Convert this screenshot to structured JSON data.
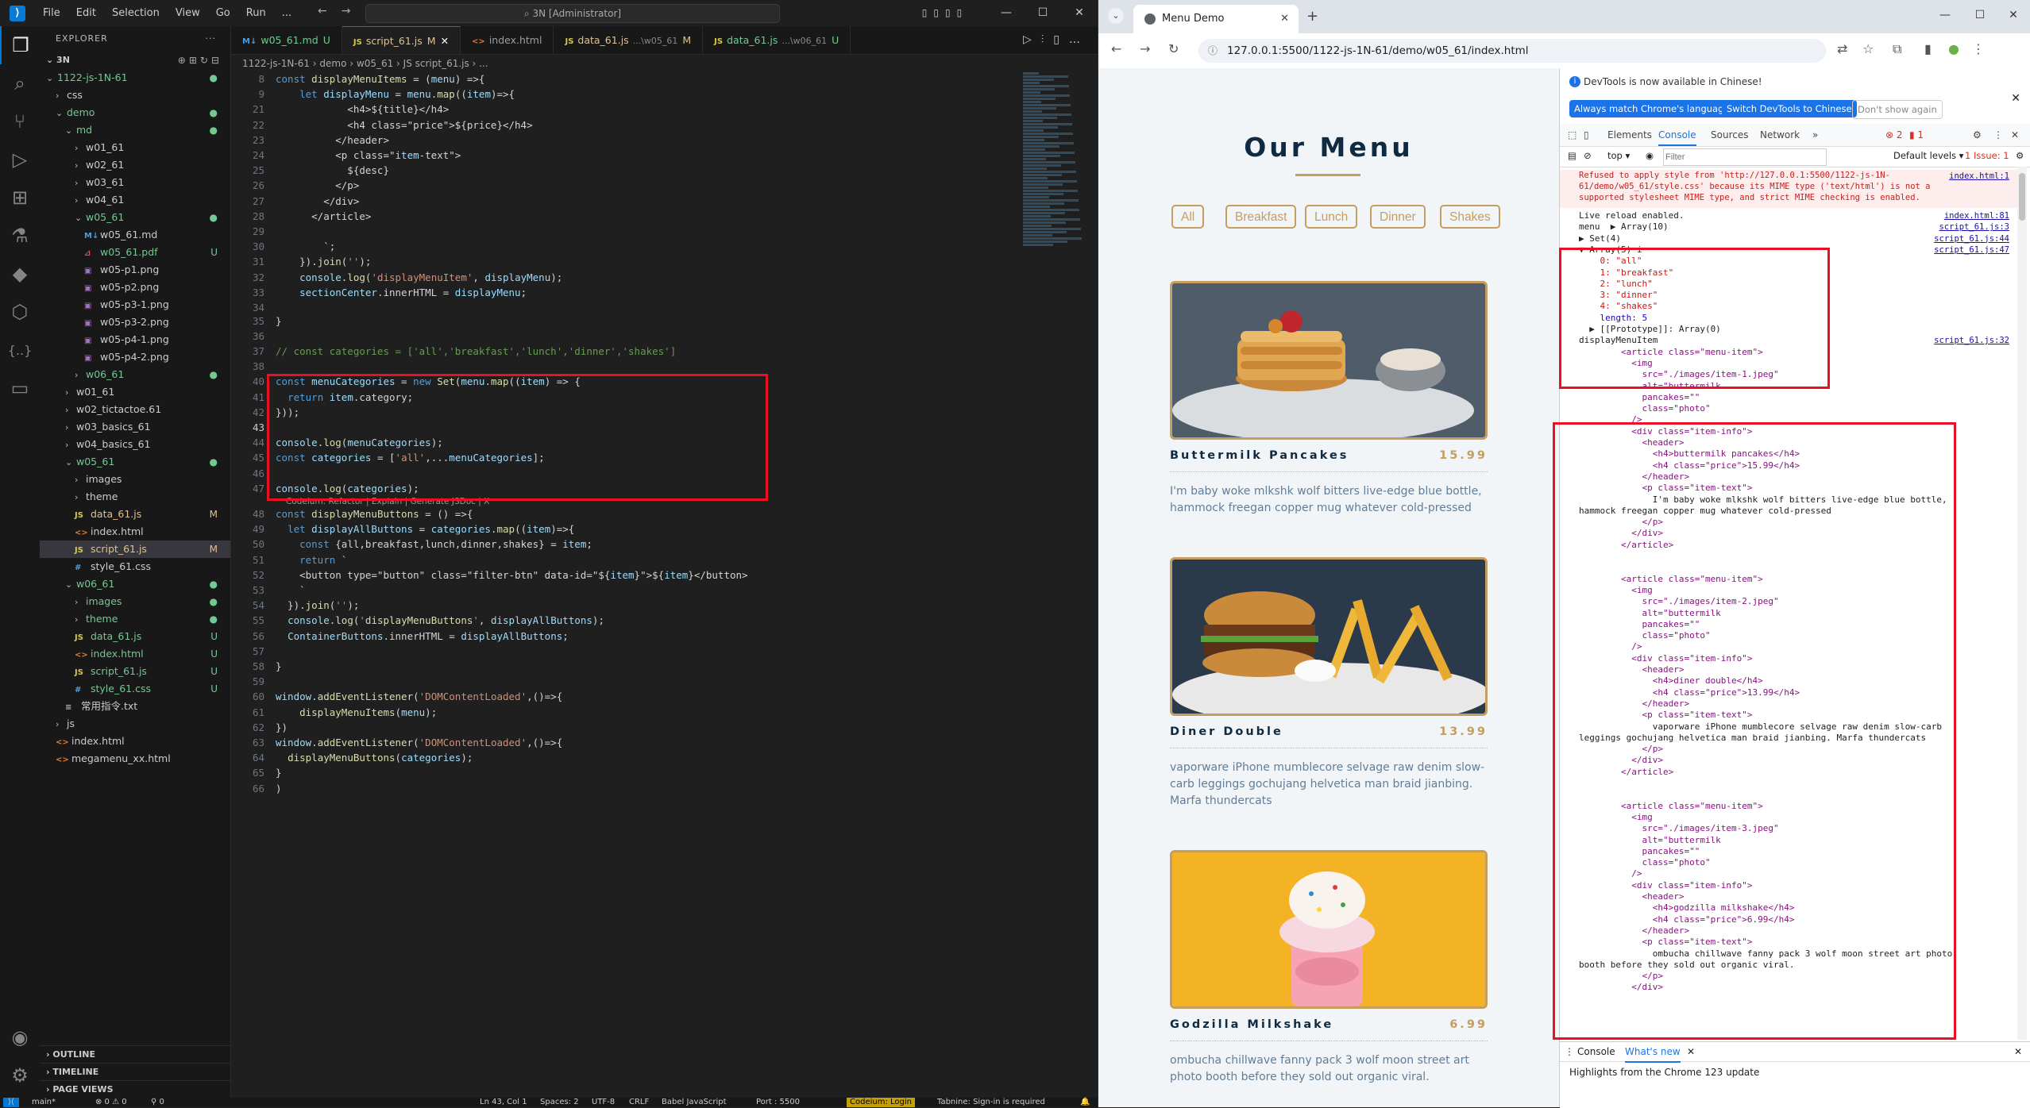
{
  "vscode": {
    "menu": [
      "File",
      "Edit",
      "Selection",
      "View",
      "Go",
      "Run",
      "..."
    ],
    "command_center": "3N [Administrator]",
    "explorer": {
      "header": "EXPLORER",
      "project": "3N",
      "tree": [
        {
          "label": "1122-js-1N-61",
          "depth": 0,
          "kind": "folder-open",
          "status": "dot"
        },
        {
          "label": "css",
          "depth": 1,
          "kind": "folder",
          "status": ""
        },
        {
          "label": "demo",
          "depth": 1,
          "kind": "folder-open",
          "status": "dot"
        },
        {
          "label": "md",
          "depth": 2,
          "kind": "folder-open",
          "status": "dot"
        },
        {
          "label": "w01_61",
          "depth": 3,
          "kind": "folder",
          "status": ""
        },
        {
          "label": "w02_61",
          "depth": 3,
          "kind": "folder",
          "status": ""
        },
        {
          "label": "w03_61",
          "depth": 3,
          "kind": "folder",
          "status": ""
        },
        {
          "label": "w04_61",
          "depth": 3,
          "kind": "folder",
          "status": ""
        },
        {
          "label": "w05_61",
          "depth": 3,
          "kind": "folder-open",
          "status": "dot"
        },
        {
          "label": "w05_61.md",
          "depth": 4,
          "kind": "md",
          "status": ""
        },
        {
          "label": "w05_61.pdf",
          "depth": 4,
          "kind": "pdf",
          "status": "U"
        },
        {
          "label": "w05-p1.png",
          "depth": 4,
          "kind": "img",
          "status": ""
        },
        {
          "label": "w05-p2.png",
          "depth": 4,
          "kind": "img",
          "status": ""
        },
        {
          "label": "w05-p3-1.png",
          "depth": 4,
          "kind": "img",
          "status": ""
        },
        {
          "label": "w05-p3-2.png",
          "depth": 4,
          "kind": "img",
          "status": ""
        },
        {
          "label": "w05-p4-1.png",
          "depth": 4,
          "kind": "img",
          "status": ""
        },
        {
          "label": "w05-p4-2.png",
          "depth": 4,
          "kind": "img",
          "status": ""
        },
        {
          "label": "w06_61",
          "depth": 3,
          "kind": "folder",
          "status": "dot"
        },
        {
          "label": "w01_61",
          "depth": 2,
          "kind": "folder",
          "status": ""
        },
        {
          "label": "w02_tictactoe.61",
          "depth": 2,
          "kind": "folder",
          "status": ""
        },
        {
          "label": "w03_basics_61",
          "depth": 2,
          "kind": "folder",
          "status": ""
        },
        {
          "label": "w04_basics_61",
          "depth": 2,
          "kind": "folder",
          "status": ""
        },
        {
          "label": "w05_61",
          "depth": 2,
          "kind": "folder-open",
          "status": "dot"
        },
        {
          "label": "images",
          "depth": 3,
          "kind": "folder",
          "status": ""
        },
        {
          "label": "theme",
          "depth": 3,
          "kind": "folder",
          "status": ""
        },
        {
          "label": "data_61.js",
          "depth": 3,
          "kind": "js",
          "status": "M"
        },
        {
          "label": "index.html",
          "depth": 3,
          "kind": "html",
          "status": ""
        },
        {
          "label": "script_61.js",
          "depth": 3,
          "kind": "js",
          "status": "M",
          "selected": true
        },
        {
          "label": "style_61.css",
          "depth": 3,
          "kind": "css",
          "status": ""
        },
        {
          "label": "w06_61",
          "depth": 2,
          "kind": "folder-open",
          "status": "dot"
        },
        {
          "label": "images",
          "depth": 3,
          "kind": "folder",
          "status": "dot"
        },
        {
          "label": "theme",
          "depth": 3,
          "kind": "folder",
          "status": "dot"
        },
        {
          "label": "data_61.js",
          "depth": 3,
          "kind": "js",
          "status": "U"
        },
        {
          "label": "index.html",
          "depth": 3,
          "kind": "html",
          "status": "U"
        },
        {
          "label": "script_61.js",
          "depth": 3,
          "kind": "js",
          "status": "U"
        },
        {
          "label": "style_61.css",
          "depth": 3,
          "kind": "css",
          "status": "U"
        },
        {
          "label": "常用指令.txt",
          "depth": 2,
          "kind": "txt",
          "status": ""
        },
        {
          "label": "js",
          "depth": 1,
          "kind": "folder",
          "status": ""
        },
        {
          "label": "index.html",
          "depth": 1,
          "kind": "html",
          "status": ""
        },
        {
          "label": "megamenu_xx.html",
          "depth": 1,
          "kind": "html",
          "status": ""
        }
      ],
      "bottom_sections": [
        "OUTLINE",
        "TIMELINE",
        "PAGE VIEWS"
      ]
    },
    "tabs": [
      {
        "icon": "md",
        "label": "w05_61.md",
        "status": "U"
      },
      {
        "icon": "js",
        "label": "script_61.js",
        "status": "M",
        "active": true
      },
      {
        "icon": "html",
        "label": "index.html",
        "status": ""
      },
      {
        "icon": "js",
        "label": "data_61.js",
        "hint": "...\\w05_61",
        "status": "M"
      },
      {
        "icon": "js",
        "label": "data_61.js",
        "hint": "...\\w06_61",
        "status": "U"
      }
    ],
    "breadcrumb": "1122-js-1N-61  ›  demo  ›  w05_61  ›  JS script_61.js  ›  ...",
    "code": [
      {
        "n": "8",
        "t": "const displayMenuItems = (menu) =>{"
      },
      {
        "n": "9",
        "t": "    let displayMenu = menu.map((item)=>{"
      },
      {
        "n": "21",
        "t": "            <h4>${title}</h4>"
      },
      {
        "n": "22",
        "t": "            <h4 class=\"price\">${price}</h4>"
      },
      {
        "n": "23",
        "t": "          </header>"
      },
      {
        "n": "24",
        "t": "          <p class=\"item-text\">"
      },
      {
        "n": "25",
        "t": "            ${desc}"
      },
      {
        "n": "26",
        "t": "          </p>"
      },
      {
        "n": "27",
        "t": "        </div>"
      },
      {
        "n": "28",
        "t": "      </article>"
      },
      {
        "n": "29",
        "t": ""
      },
      {
        "n": "30",
        "t": "        `;"
      },
      {
        "n": "31",
        "t": "    }).join('');"
      },
      {
        "n": "32",
        "t": "    console.log('displayMenuItem', displayMenu);"
      },
      {
        "n": "33",
        "t": "    sectionCenter.innerHTML = displayMenu;"
      },
      {
        "n": "34",
        "t": ""
      },
      {
        "n": "35",
        "t": "}"
      },
      {
        "n": "36",
        "t": ""
      },
      {
        "n": "37",
        "t": "// const categories = ['all','breakfast','lunch','dinner','shakes']"
      },
      {
        "n": "38",
        "t": ""
      },
      {
        "n": "40",
        "t": "const menuCategories = new Set(menu.map((item) => {"
      },
      {
        "n": "41",
        "t": "  return item.category;"
      },
      {
        "n": "42",
        "t": "}));"
      },
      {
        "n": "43",
        "t": ""
      },
      {
        "n": "44",
        "t": "console.log(menuCategories);"
      },
      {
        "n": "45",
        "t": "const categories = ['all',...menuCategories];"
      },
      {
        "n": "46",
        "t": ""
      },
      {
        "n": "47",
        "t": "console.log(categories);"
      },
      {
        "n": "48",
        "t": "const displayMenuButtons = () =>{"
      },
      {
        "n": "49",
        "t": "  let displayAllButtons = categories.map((item)=>{"
      },
      {
        "n": "50",
        "t": "    const {all,breakfast,lunch,dinner,shakes} = item;"
      },
      {
        "n": "51",
        "t": "    return `"
      },
      {
        "n": "52",
        "t": "    <button type=\"button\" class=\"filter-btn\" data-id=\"${item}\">${item}</button>"
      },
      {
        "n": "53",
        "t": "    `"
      },
      {
        "n": "54",
        "t": "  }).join('');"
      },
      {
        "n": "55",
        "t": "  console.log('displayMenuButtons', displayAllButtons);"
      },
      {
        "n": "56",
        "t": "  ContainerButtons.innerHTML = displayAllButtons;"
      },
      {
        "n": "57",
        "t": ""
      },
      {
        "n": "58",
        "t": "}"
      },
      {
        "n": "59",
        "t": ""
      },
      {
        "n": "60",
        "t": "window.addEventListener('DOMContentLoaded',()=>{"
      },
      {
        "n": "61",
        "t": "    displayMenuItems(menu);"
      },
      {
        "n": "62",
        "t": "})"
      },
      {
        "n": "63",
        "t": "window.addEventListener('DOMContentLoaded',()=>{"
      },
      {
        "n": "64",
        "t": "  displayMenuButtons(categories);"
      },
      {
        "n": "65",
        "t": "}"
      },
      {
        "n": "66",
        "t": ")"
      }
    ],
    "codelens": "Codeium: Refactor | Explain | Generate JSDoc | X",
    "status": {
      "branch": "main*",
      "problems": "⊗ 0 ⚠ 0",
      "ports": "⚲ 0",
      "position": "Ln 43, Col 1",
      "spaces": "Spaces: 2",
      "encoding": "UTF-8",
      "eol": "CRLF",
      "language": "Babel JavaScript",
      "port": "Port : 5500",
      "codeium": "Codeium: Login",
      "tabnine": "Tabnine: Sign-in is required"
    }
  },
  "chrome": {
    "tab_title": "Menu Demo",
    "url": "127.0.0.1:5500/1122-js-1N-61/demo/w05_61/index.html",
    "page": {
      "title": "Our Menu",
      "filters": [
        "All",
        "Breakfast",
        "Lunch",
        "Dinner",
        "Shakes"
      ],
      "items": [
        {
          "name": "Buttermilk Pancakes",
          "price": "15.99",
          "desc": "I'm baby woke mlkshk wolf bitters live-edge blue bottle, hammock freegan copper mug whatever cold-pressed"
        },
        {
          "name": "Diner Double",
          "price": "13.99",
          "desc": "vaporware iPhone mumblecore selvage raw denim slow-carb leggings gochujang helvetica man braid jianbing. Marfa thundercats"
        },
        {
          "name": "Godzilla Milkshake",
          "price": "6.99",
          "desc": "ombucha chillwave fanny pack 3 wolf moon street art photo booth before they sold out organic viral."
        }
      ]
    },
    "devtools": {
      "banner": "DevTools is now available in Chinese!",
      "banner_btn1": "Always match Chrome's language",
      "banner_btn2": "Switch DevTools to Chinese",
      "banner_btn3": "Don't show again",
      "tabs": [
        "Elements",
        "Console",
        "Sources",
        "Network",
        "»"
      ],
      "errors": "2",
      "warnings": "1",
      "context": "top ▾",
      "filter_placeholder": "Filter",
      "levels": "Default levels ▾",
      "issues": "1 Issue: 1",
      "console": [
        {
          "text": "Refused to apply style from 'http://127.0.0.1:5500/1122-js-1N-61/demo/w05_61/style.css' because its MIME type ('text/html') is not a supported stylesheet MIME type, and strict MIME checking is enabled.",
          "src": "index.html:1",
          "type": "err"
        },
        {
          "text": "Live reload enabled.",
          "src": "index.html:81",
          "type": ""
        },
        {
          "text": "menu  ▶ Array(10)",
          "src": "script_61.js:3",
          "type": ""
        },
        {
          "text": "▶ Set(4)",
          "src": "script_61.js:44",
          "type": ""
        },
        {
          "text": "▼ Array(5) i",
          "src": "script_61.js:47",
          "type": ""
        },
        {
          "text": "    0: \"all\"",
          "src": "",
          "type": "str"
        },
        {
          "text": "    1: \"breakfast\"",
          "src": "",
          "type": "str"
        },
        {
          "text": "    2: \"lunch\"",
          "src": "",
          "type": "str"
        },
        {
          "text": "    3: \"dinner\"",
          "src": "",
          "type": "str"
        },
        {
          "text": "    4: \"shakes\"",
          "src": "",
          "type": "str"
        },
        {
          "text": "    length: 5",
          "src": "",
          "type": "num"
        },
        {
          "text": "  ▶ [[Prototype]]: Array(0)",
          "src": "",
          "type": ""
        },
        {
          "text": "displayMenuItem",
          "src": "script_61.js:32",
          "type": ""
        },
        {
          "text": "        <article class=\"menu-item\">",
          "src": "",
          "type": "tag"
        },
        {
          "text": "          <img",
          "src": "",
          "type": "tag"
        },
        {
          "text": "            src=\"./images/item-1.jpeg\"",
          "src": "",
          "type": "tag"
        },
        {
          "text": "            alt=\"buttermilk",
          "src": "",
          "type": "tag"
        },
        {
          "text": "            pancakes=\"\"",
          "src": "",
          "type": "tag"
        },
        {
          "text": "            class=\"photo\"",
          "src": "",
          "type": "tag"
        },
        {
          "text": "          />",
          "src": "",
          "type": "tag"
        },
        {
          "text": "          <div class=\"item-info\">",
          "src": "",
          "type": "tag"
        },
        {
          "text": "            <header>",
          "src": "",
          "type": "tag"
        },
        {
          "text": "              <h4>buttermilk pancakes</h4>",
          "src": "",
          "type": "tag"
        },
        {
          "text": "              <h4 class=\"price\">15.99</h4>",
          "src": "",
          "type": "tag"
        },
        {
          "text": "            </header>",
          "src": "",
          "type": "tag"
        },
        {
          "text": "            <p class=\"item-text\">",
          "src": "",
          "type": "tag"
        },
        {
          "text": "              I'm baby woke mlkshk wolf bitters live-edge blue bottle,",
          "src": "",
          "type": ""
        },
        {
          "text": "hammock freegan copper mug whatever cold-pressed",
          "src": "",
          "type": ""
        },
        {
          "text": "            </p>",
          "src": "",
          "type": "tag"
        },
        {
          "text": "          </div>",
          "src": "",
          "type": "tag"
        },
        {
          "text": "        </article>",
          "src": "",
          "type": "tag"
        },
        {
          "text": "",
          "src": "",
          "type": ""
        },
        {
          "text": "",
          "src": "",
          "type": ""
        },
        {
          "text": "        <article class=\"menu-item\">",
          "src": "",
          "type": "tag"
        },
        {
          "text": "          <img",
          "src": "",
          "type": "tag"
        },
        {
          "text": "            src=\"./images/item-2.jpeg\"",
          "src": "",
          "type": "tag"
        },
        {
          "text": "            alt=\"buttermilk",
          "src": "",
          "type": "tag"
        },
        {
          "text": "            pancakes=\"\"",
          "src": "",
          "type": "tag"
        },
        {
          "text": "            class=\"photo\"",
          "src": "",
          "type": "tag"
        },
        {
          "text": "          />",
          "src": "",
          "type": "tag"
        },
        {
          "text": "          <div class=\"item-info\">",
          "src": "",
          "type": "tag"
        },
        {
          "text": "            <header>",
          "src": "",
          "type": "tag"
        },
        {
          "text": "              <h4>diner double</h4>",
          "src": "",
          "type": "tag"
        },
        {
          "text": "              <h4 class=\"price\">13.99</h4>",
          "src": "",
          "type": "tag"
        },
        {
          "text": "            </header>",
          "src": "",
          "type": "tag"
        },
        {
          "text": "            <p class=\"item-text\">",
          "src": "",
          "type": "tag"
        },
        {
          "text": "              vaporware iPhone mumblecore selvage raw denim slow-carb",
          "src": "",
          "type": ""
        },
        {
          "text": "leggings gochujang helvetica man braid jianbing. Marfa thundercats",
          "src": "",
          "type": ""
        },
        {
          "text": "            </p>",
          "src": "",
          "type": "tag"
        },
        {
          "text": "          </div>",
          "src": "",
          "type": "tag"
        },
        {
          "text": "        </article>",
          "src": "",
          "type": "tag"
        },
        {
          "text": "",
          "src": "",
          "type": ""
        },
        {
          "text": "",
          "src": "",
          "type": ""
        },
        {
          "text": "        <article class=\"menu-item\">",
          "src": "",
          "type": "tag"
        },
        {
          "text": "          <img",
          "src": "",
          "type": "tag"
        },
        {
          "text": "            src=\"./images/item-3.jpeg\"",
          "src": "",
          "type": "tag"
        },
        {
          "text": "            alt=\"buttermilk",
          "src": "",
          "type": "tag"
        },
        {
          "text": "            pancakes=\"\"",
          "src": "",
          "type": "tag"
        },
        {
          "text": "            class=\"photo\"",
          "src": "",
          "type": "tag"
        },
        {
          "text": "          />",
          "src": "",
          "type": "tag"
        },
        {
          "text": "          <div class=\"item-info\">",
          "src": "",
          "type": "tag"
        },
        {
          "text": "            <header>",
          "src": "",
          "type": "tag"
        },
        {
          "text": "              <h4>godzilla milkshake</h4>",
          "src": "",
          "type": "tag"
        },
        {
          "text": "              <h4 class=\"price\">6.99</h4>",
          "src": "",
          "type": "tag"
        },
        {
          "text": "            </header>",
          "src": "",
          "type": "tag"
        },
        {
          "text": "            <p class=\"item-text\">",
          "src": "",
          "type": "tag"
        },
        {
          "text": "              ombucha chillwave fanny pack 3 wolf moon street art photo",
          "src": "",
          "type": ""
        },
        {
          "text": "booth before they sold out organic viral.",
          "src": "",
          "type": ""
        },
        {
          "text": "            </p>",
          "src": "",
          "type": "tag"
        },
        {
          "text": "          </div>",
          "src": "",
          "type": "tag"
        }
      ],
      "drawer_tabs": [
        "Console",
        "What's new"
      ],
      "drawer_text": "Highlights from the Chrome 123 update"
    }
  }
}
